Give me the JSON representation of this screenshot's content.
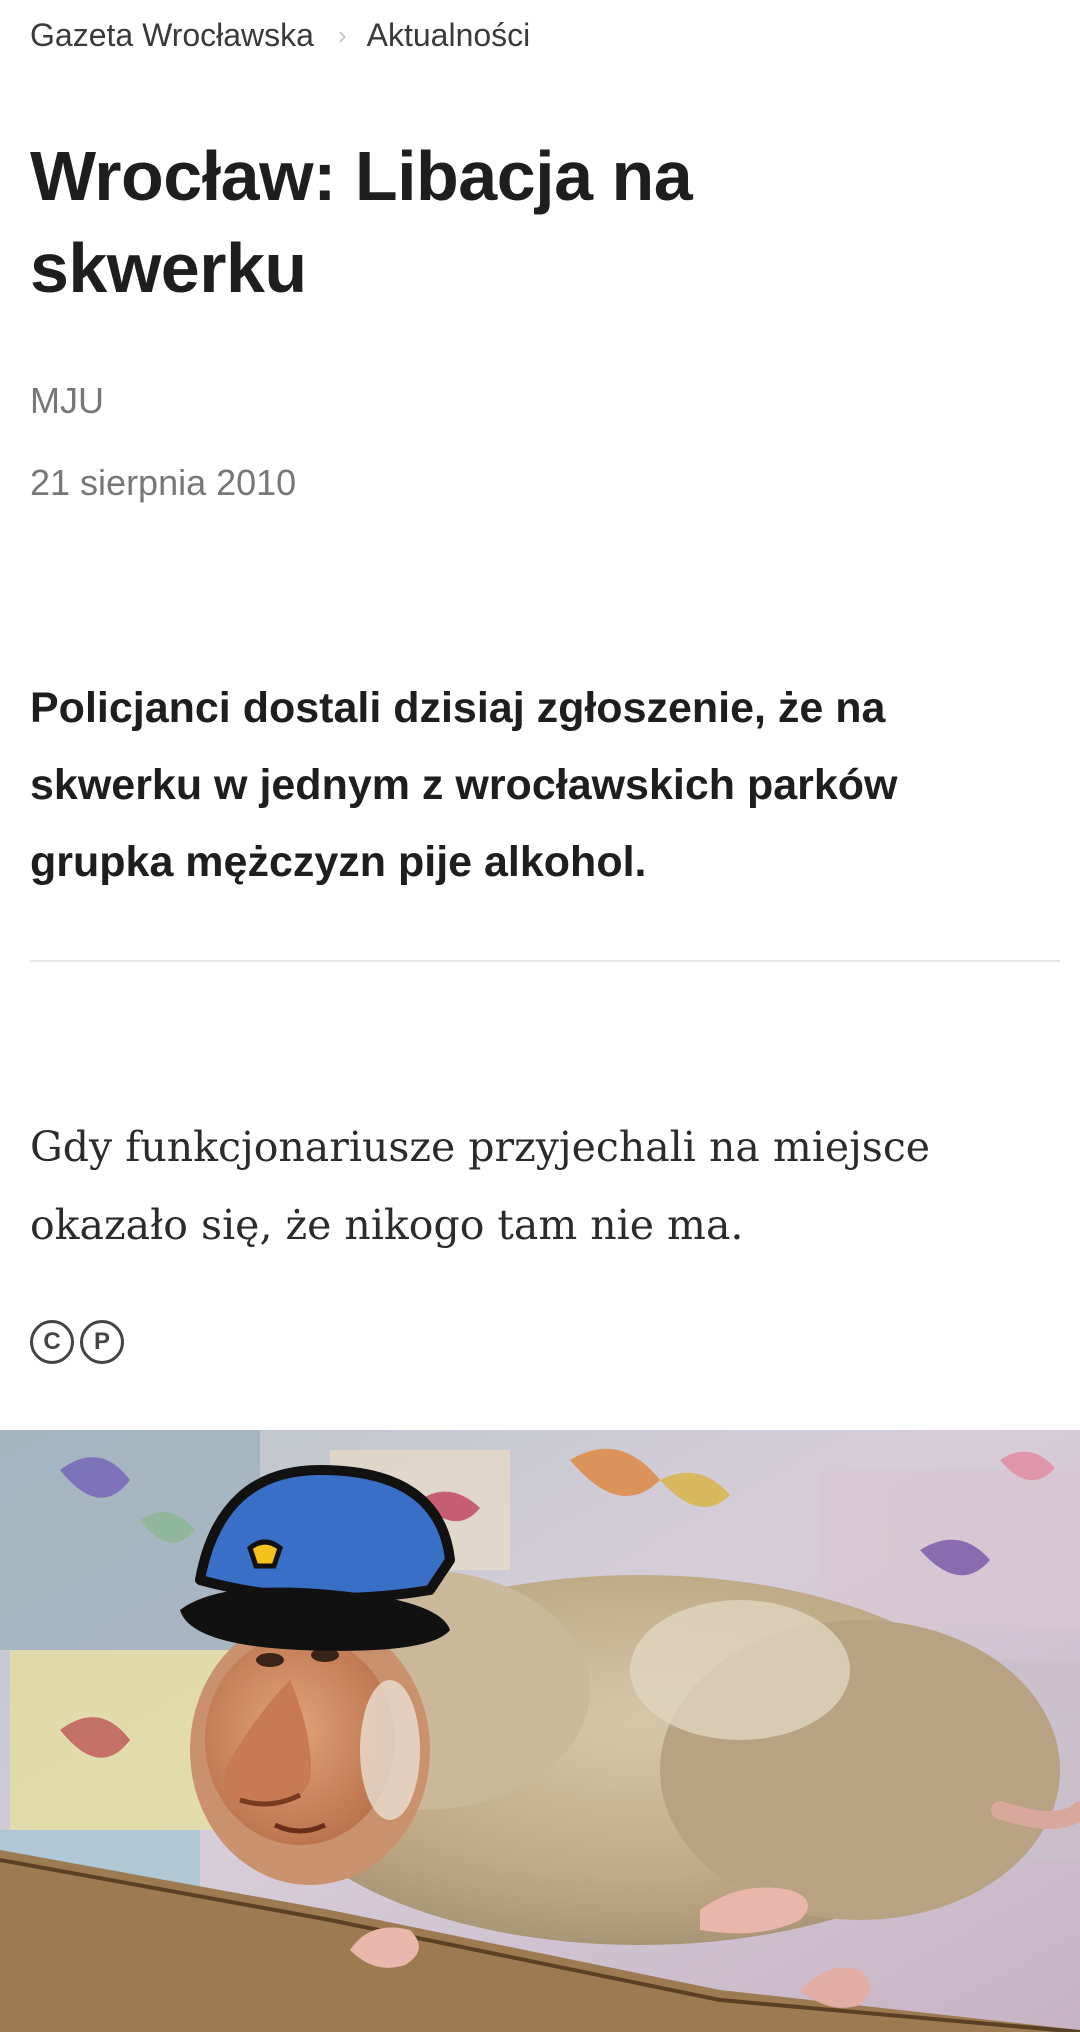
{
  "breadcrumb": {
    "site": "Gazeta Wrocławska",
    "separator": "›",
    "section": "Aktualności"
  },
  "article": {
    "title": "Wrocław: Libacja na skwerku",
    "author": "MJU",
    "date": "21 sierpnia 2010",
    "lead": "Policjanci dostali dzisiaj zgłoszenie, że na skwerku w jednym z wrocławskich parków grupka mężczyzn pije alkohol.",
    "body": "Gdy funkcjonariusze przyjechali na miejsce okazało się, że nikogo tam nie ma."
  },
  "license": {
    "icons": [
      {
        "name": "copyright-icon",
        "glyph": "C"
      },
      {
        "name": "press-icon",
        "glyph": "P"
      }
    ]
  },
  "photo": {
    "subject": "rat-with-proboscis-monkey-face-and-police-cap",
    "colors": {
      "cap": "#3a6fc8",
      "cap_badge": "#f2c21b",
      "rat_fur": "#c2ad8f",
      "monkey_skin": "#d49068"
    }
  }
}
